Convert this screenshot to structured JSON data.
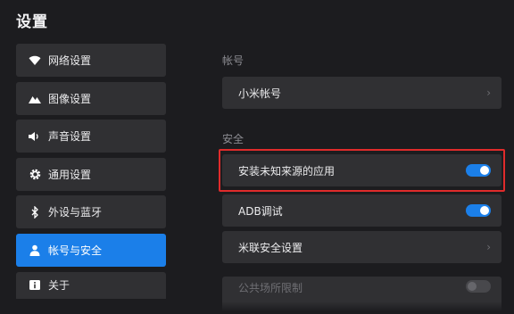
{
  "page": {
    "title": "设置"
  },
  "sidebar": {
    "items": [
      {
        "label": "网络设置",
        "icon": "wifi-icon"
      },
      {
        "label": "图像设置",
        "icon": "image-icon"
      },
      {
        "label": "声音设置",
        "icon": "speaker-icon"
      },
      {
        "label": "通用设置",
        "icon": "gear-icon"
      },
      {
        "label": "外设与蓝牙",
        "icon": "bluetooth-icon"
      },
      {
        "label": "帐号与安全",
        "icon": "user-icon",
        "active": true
      },
      {
        "label": "关于",
        "icon": "info-icon"
      }
    ]
  },
  "main": {
    "account_section_label": "帐号",
    "account_row_label": "小米帐号",
    "security_section_label": "安全",
    "security_rows": [
      {
        "label": "安装未知来源的应用",
        "control": "toggle",
        "on": true,
        "highlighted": true
      },
      {
        "label": "ADB调试",
        "control": "toggle",
        "on": true
      },
      {
        "label": "米联安全设置",
        "control": "chevron"
      },
      {
        "label": "公共场所限制",
        "control": "toggle",
        "on": false,
        "disabled": true
      }
    ]
  },
  "colors": {
    "accent": "#1b7fe9",
    "highlight_border": "#e02b2b",
    "background": "#1c1c1f",
    "panel": "#303033"
  }
}
